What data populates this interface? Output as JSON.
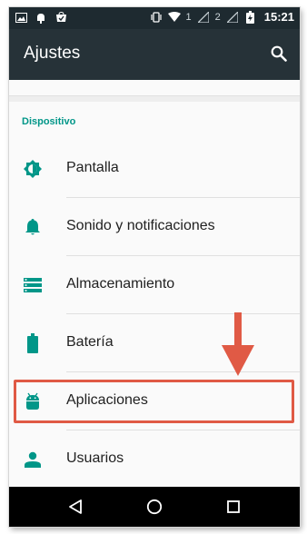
{
  "status_bar": {
    "sim1": "1",
    "sim2": "2",
    "time": "15:21"
  },
  "toolbar": {
    "title": "Ajustes"
  },
  "section": {
    "title": "Dispositivo"
  },
  "items": [
    {
      "label": "Pantalla",
      "icon": "brightness-icon"
    },
    {
      "label": "Sonido y notificaciones",
      "icon": "bell-icon"
    },
    {
      "label": "Almacenamiento",
      "icon": "storage-icon"
    },
    {
      "label": "Batería",
      "icon": "battery-icon"
    },
    {
      "label": "Aplicaciones",
      "icon": "android-icon"
    },
    {
      "label": "Usuarios",
      "icon": "person-icon"
    }
  ],
  "colors": {
    "accent": "#009688",
    "toolbar": "#263238",
    "highlight": "#e05a45"
  }
}
